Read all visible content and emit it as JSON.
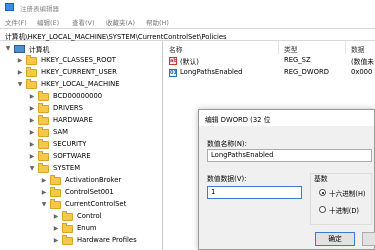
{
  "window": {
    "title": "注册表编辑器"
  },
  "menu": [
    "文件(F)",
    "编辑(E)",
    "查看(V)",
    "收藏夹(A)",
    "帮助(H)"
  ],
  "address": "计算机\\HKEY_LOCAL_MACHINE\\SYSTEM\\CurrentControlSet\\Policies",
  "tree": [
    {
      "label": "计算机",
      "icon": "computer-icon",
      "arrow": "down"
    },
    {
      "label": "HKEY_CLASSES_ROOT",
      "arrow": "right"
    },
    {
      "label": "HKEY_CURRENT_USER",
      "arrow": "right"
    },
    {
      "label": "HKEY_LOCAL_MACHINE",
      "arrow": "down"
    },
    {
      "label": "BCD00000000",
      "arrow": "right"
    },
    {
      "label": "DRIVERS",
      "arrow": "right"
    },
    {
      "label": "HARDWARE",
      "arrow": "right"
    },
    {
      "label": "SAM",
      "arrow": "right"
    },
    {
      "label": "SECURITY",
      "arrow": "right"
    },
    {
      "label": "SOFTWARE",
      "arrow": "right"
    },
    {
      "label": "SYSTEM",
      "arrow": "down"
    },
    {
      "label": "ActivationBroker",
      "arrow": "right"
    },
    {
      "label": "ControlSet001",
      "arrow": "right"
    },
    {
      "label": "CurrentControlSet",
      "arrow": "down"
    },
    {
      "label": "Control",
      "arrow": "right"
    },
    {
      "label": "Enum",
      "arrow": "right"
    },
    {
      "label": "Hardware Profiles",
      "arrow": "right"
    }
  ],
  "list": {
    "headers": {
      "name": "名称",
      "type": "类型",
      "data": "数据"
    },
    "rows": [
      {
        "icon": "string-value-icon",
        "name": "(默认)",
        "type": "REG_SZ",
        "data": "(数值未"
      },
      {
        "icon": "dword-value-icon",
        "name": "LongPathsEnabled",
        "type": "REG_DWORD",
        "data": "0x000"
      }
    ]
  },
  "dialog": {
    "title": "编辑 DWORD (32 位",
    "name_label": "数值名称(N):",
    "name_value": "LongPathsEnabled",
    "data_label": "数值数据(V):",
    "data_value": "1",
    "base_label": "基数",
    "radio_hex": "十六进制(H)",
    "radio_dec": "十进制(D)",
    "base_selected": "hex",
    "ok": "确定",
    "cancel": ""
  },
  "colors": {
    "accent": "#3a7bd5",
    "folder": "#f2c94c",
    "dialog_bg": "#f0f0f0"
  }
}
